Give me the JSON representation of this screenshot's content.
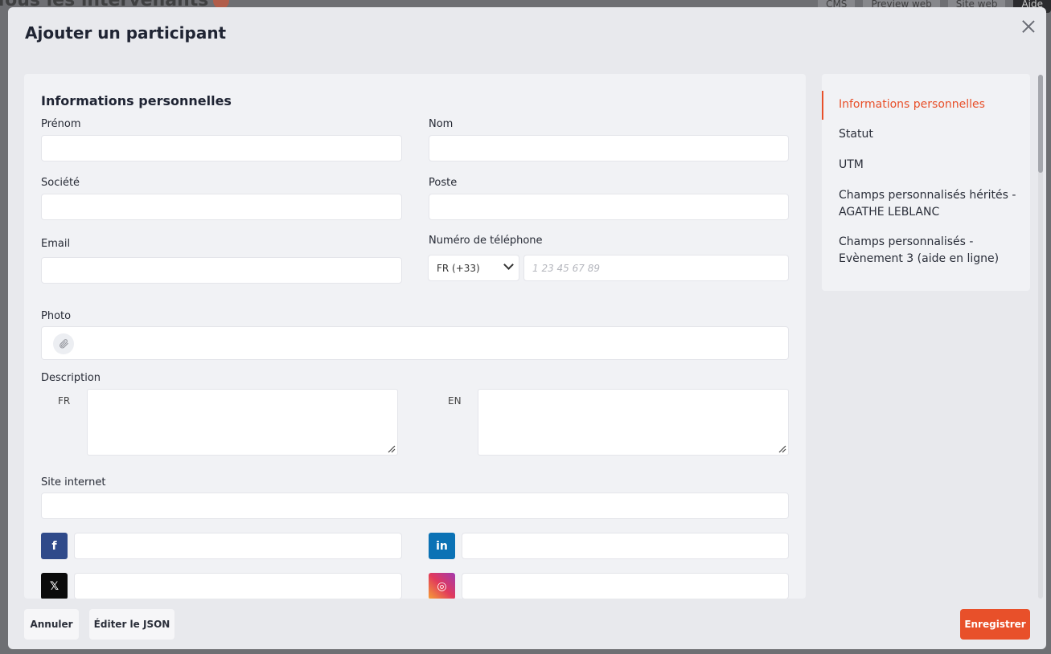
{
  "background": {
    "title": "Tous les intervenants",
    "top_buttons": [
      "CMS",
      "Preview web",
      "Site web",
      "Aide"
    ]
  },
  "modal": {
    "title": "Ajouter un participant",
    "section_title": "Informations personnelles",
    "fields": {
      "prenom": {
        "label": "Prénom",
        "value": ""
      },
      "nom": {
        "label": "Nom",
        "value": ""
      },
      "societe": {
        "label": "Société",
        "value": ""
      },
      "poste": {
        "label": "Poste",
        "value": ""
      },
      "email": {
        "label": "Email",
        "value": ""
      },
      "phone": {
        "label": "Numéro de téléphone",
        "country": "FR (+33)",
        "placeholder": "1 23 45 67 89",
        "value": ""
      },
      "photo": {
        "label": "Photo"
      },
      "description": {
        "label": "Description",
        "lang_fr": "FR",
        "lang_en": "EN"
      },
      "site": {
        "label": "Site internet",
        "value": ""
      }
    },
    "social": [
      {
        "name": "facebook",
        "glyph": "f",
        "color": "#2f4a8a"
      },
      {
        "name": "linkedin",
        "glyph": "in",
        "color": "#0b72b5"
      },
      {
        "name": "x",
        "glyph": "𝕏",
        "color": "#0b0b0b"
      },
      {
        "name": "instagram",
        "glyph": "◎",
        "color": "#e13a5c"
      }
    ],
    "nav": [
      {
        "label": "Informations personnelles",
        "active": true
      },
      {
        "label": "Statut",
        "active": false
      },
      {
        "label": "UTM",
        "active": false
      },
      {
        "label": "Champs personnalisés hérités - AGATHE LEBLANC",
        "active": false
      },
      {
        "label": "Champs personnalisés - Evènement 3 (aide en ligne)",
        "active": false
      }
    ],
    "buttons": {
      "cancel": "Annuler",
      "edit_json": "Éditer le JSON",
      "save": "Enregistrer"
    },
    "colors": {
      "accent": "#e8502a",
      "panel": "#f1f2f5"
    }
  }
}
